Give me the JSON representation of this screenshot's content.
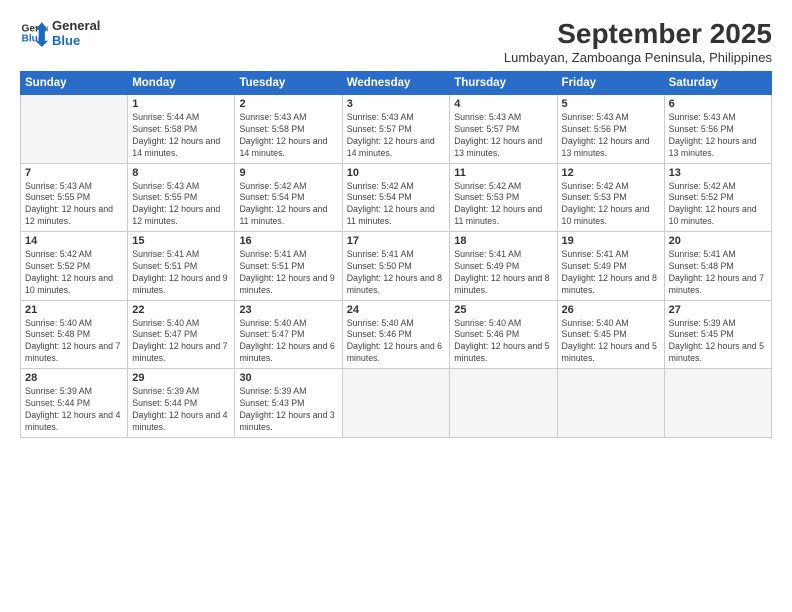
{
  "logo": {
    "line1": "General",
    "line2": "Blue"
  },
  "title": "September 2025",
  "subtitle": "Lumbayan, Zamboanga Peninsula, Philippines",
  "header_days": [
    "Sunday",
    "Monday",
    "Tuesday",
    "Wednesday",
    "Thursday",
    "Friday",
    "Saturday"
  ],
  "weeks": [
    [
      {
        "day": "",
        "info": ""
      },
      {
        "day": "1",
        "info": "Sunrise: 5:44 AM\nSunset: 5:58 PM\nDaylight: 12 hours\nand 14 minutes."
      },
      {
        "day": "2",
        "info": "Sunrise: 5:43 AM\nSunset: 5:58 PM\nDaylight: 12 hours\nand 14 minutes."
      },
      {
        "day": "3",
        "info": "Sunrise: 5:43 AM\nSunset: 5:57 PM\nDaylight: 12 hours\nand 14 minutes."
      },
      {
        "day": "4",
        "info": "Sunrise: 5:43 AM\nSunset: 5:57 PM\nDaylight: 12 hours\nand 13 minutes."
      },
      {
        "day": "5",
        "info": "Sunrise: 5:43 AM\nSunset: 5:56 PM\nDaylight: 12 hours\nand 13 minutes."
      },
      {
        "day": "6",
        "info": "Sunrise: 5:43 AM\nSunset: 5:56 PM\nDaylight: 12 hours\nand 13 minutes."
      }
    ],
    [
      {
        "day": "7",
        "info": "Sunrise: 5:43 AM\nSunset: 5:55 PM\nDaylight: 12 hours\nand 12 minutes."
      },
      {
        "day": "8",
        "info": "Sunrise: 5:43 AM\nSunset: 5:55 PM\nDaylight: 12 hours\nand 12 minutes."
      },
      {
        "day": "9",
        "info": "Sunrise: 5:42 AM\nSunset: 5:54 PM\nDaylight: 12 hours\nand 11 minutes."
      },
      {
        "day": "10",
        "info": "Sunrise: 5:42 AM\nSunset: 5:54 PM\nDaylight: 12 hours\nand 11 minutes."
      },
      {
        "day": "11",
        "info": "Sunrise: 5:42 AM\nSunset: 5:53 PM\nDaylight: 12 hours\nand 11 minutes."
      },
      {
        "day": "12",
        "info": "Sunrise: 5:42 AM\nSunset: 5:53 PM\nDaylight: 12 hours\nand 10 minutes."
      },
      {
        "day": "13",
        "info": "Sunrise: 5:42 AM\nSunset: 5:52 PM\nDaylight: 12 hours\nand 10 minutes."
      }
    ],
    [
      {
        "day": "14",
        "info": "Sunrise: 5:42 AM\nSunset: 5:52 PM\nDaylight: 12 hours\nand 10 minutes."
      },
      {
        "day": "15",
        "info": "Sunrise: 5:41 AM\nSunset: 5:51 PM\nDaylight: 12 hours\nand 9 minutes."
      },
      {
        "day": "16",
        "info": "Sunrise: 5:41 AM\nSunset: 5:51 PM\nDaylight: 12 hours\nand 9 minutes."
      },
      {
        "day": "17",
        "info": "Sunrise: 5:41 AM\nSunset: 5:50 PM\nDaylight: 12 hours\nand 8 minutes."
      },
      {
        "day": "18",
        "info": "Sunrise: 5:41 AM\nSunset: 5:49 PM\nDaylight: 12 hours\nand 8 minutes."
      },
      {
        "day": "19",
        "info": "Sunrise: 5:41 AM\nSunset: 5:49 PM\nDaylight: 12 hours\nand 8 minutes."
      },
      {
        "day": "20",
        "info": "Sunrise: 5:41 AM\nSunset: 5:48 PM\nDaylight: 12 hours\nand 7 minutes."
      }
    ],
    [
      {
        "day": "21",
        "info": "Sunrise: 5:40 AM\nSunset: 5:48 PM\nDaylight: 12 hours\nand 7 minutes."
      },
      {
        "day": "22",
        "info": "Sunrise: 5:40 AM\nSunset: 5:47 PM\nDaylight: 12 hours\nand 7 minutes."
      },
      {
        "day": "23",
        "info": "Sunrise: 5:40 AM\nSunset: 5:47 PM\nDaylight: 12 hours\nand 6 minutes."
      },
      {
        "day": "24",
        "info": "Sunrise: 5:40 AM\nSunset: 5:46 PM\nDaylight: 12 hours\nand 6 minutes."
      },
      {
        "day": "25",
        "info": "Sunrise: 5:40 AM\nSunset: 5:46 PM\nDaylight: 12 hours\nand 5 minutes."
      },
      {
        "day": "26",
        "info": "Sunrise: 5:40 AM\nSunset: 5:45 PM\nDaylight: 12 hours\nand 5 minutes."
      },
      {
        "day": "27",
        "info": "Sunrise: 5:39 AM\nSunset: 5:45 PM\nDaylight: 12 hours\nand 5 minutes."
      }
    ],
    [
      {
        "day": "28",
        "info": "Sunrise: 5:39 AM\nSunset: 5:44 PM\nDaylight: 12 hours\nand 4 minutes."
      },
      {
        "day": "29",
        "info": "Sunrise: 5:39 AM\nSunset: 5:44 PM\nDaylight: 12 hours\nand 4 minutes."
      },
      {
        "day": "30",
        "info": "Sunrise: 5:39 AM\nSunset: 5:43 PM\nDaylight: 12 hours\nand 3 minutes."
      },
      {
        "day": "",
        "info": ""
      },
      {
        "day": "",
        "info": ""
      },
      {
        "day": "",
        "info": ""
      },
      {
        "day": "",
        "info": ""
      }
    ]
  ]
}
